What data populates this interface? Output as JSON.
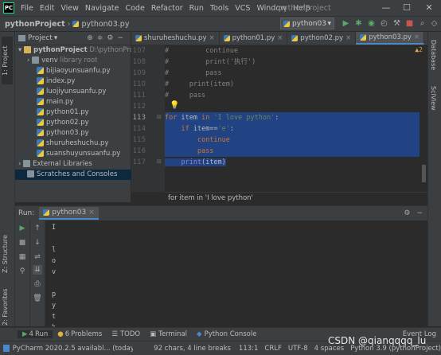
{
  "menu": {
    "logo": "PC",
    "items": [
      "File",
      "Edit",
      "View",
      "Navigate",
      "Code",
      "Refactor",
      "Run",
      "Tools",
      "VCS",
      "Window",
      "Help"
    ],
    "window_title": "pythonProject",
    "minimize": "—",
    "maximize": "☐",
    "close": "✕"
  },
  "nav": {
    "project": "pythonProject",
    "separator": "›",
    "file": "python03.py",
    "run_config": "python03",
    "run_config_arrow": "▾"
  },
  "left_strip": {
    "project_tab": "1: Project",
    "structure_tab": "Z: Structure",
    "favorites_tab": "2: Favorites"
  },
  "right_strip": {
    "database_tab": "Database",
    "sciview_tab": "SciView"
  },
  "project_panel": {
    "title": "Project",
    "title_arrow": "▾",
    "root_name": "pythonProject",
    "root_path": "D:\\pythonProje",
    "venv": "venv",
    "venv_note": "library root",
    "files": [
      "bijiaoyunsuanfu.py",
      "index.py",
      "luojiyunsuanfu.py",
      "main.py",
      "python01.py",
      "python02.py",
      "python03.py",
      "shuruheshuchu.py",
      "suanshuyunsuanfu.py"
    ],
    "external_libraries": "External Libraries",
    "scratches": "Scratches and Consoles"
  },
  "editor": {
    "tabs": [
      "shuruheshuchu.py",
      "python01.py",
      "python02.py",
      "python03.py"
    ],
    "active_tab": "python03.py",
    "warning_count": "▲2",
    "line_numbers": [
      "107",
      "108",
      "109",
      "110",
      "111",
      "112",
      "113",
      "114",
      "115",
      "116",
      "117"
    ],
    "comment_lines": [
      {
        "ln": "107",
        "text": "#         continue"
      },
      {
        "ln": "108",
        "text": "#         print('执行')"
      },
      {
        "ln": "109",
        "text": "#         pass"
      },
      {
        "ln": "110",
        "text": "#     print(item)"
      },
      {
        "ln": "111",
        "text": "#     pass"
      }
    ],
    "code": {
      "l113_for": "for",
      "l113_item": " item ",
      "l113_in": "in",
      "l113_str": " 'I love python'",
      "l113_colon": ":",
      "l114_if": "if",
      "l114_rest": " item==",
      "l114_str": "'e'",
      "l114_colon": ":",
      "l115": "continue",
      "l116": "pass",
      "l117_print": "print",
      "l117_rest": "(item)"
    },
    "breadcrumb": "for item in 'I love python'"
  },
  "run_panel": {
    "label": "Run:",
    "config": "python03",
    "output": [
      "I",
      "",
      "l",
      "o",
      "v",
      "",
      "p",
      "y",
      "t",
      "h"
    ]
  },
  "bottom_tools": [
    {
      "num": "4",
      "label": "Run"
    },
    {
      "num": "6",
      "label": "Problems"
    },
    {
      "num": "",
      "label": "TODO"
    },
    {
      "num": "",
      "label": "Terminal"
    },
    {
      "num": "",
      "label": "Python Console"
    }
  ],
  "event_log": "Event Log",
  "status": {
    "message": "PyCharm 2020.2.5 availabl... (today 15:20)",
    "chars": "92 chars, 4 line breaks",
    "position": "113:1",
    "line_sep": "CRLF",
    "encoding": "UTF-8",
    "indent": "4 spaces",
    "interpreter": "Python 3.9 (pythonProject)"
  },
  "watermark": "CSDN @qianqqqq_lu",
  "colors": {
    "selection": "#214283",
    "keyword": "#cc7832",
    "string": "#6a8759",
    "comment": "#808080"
  }
}
